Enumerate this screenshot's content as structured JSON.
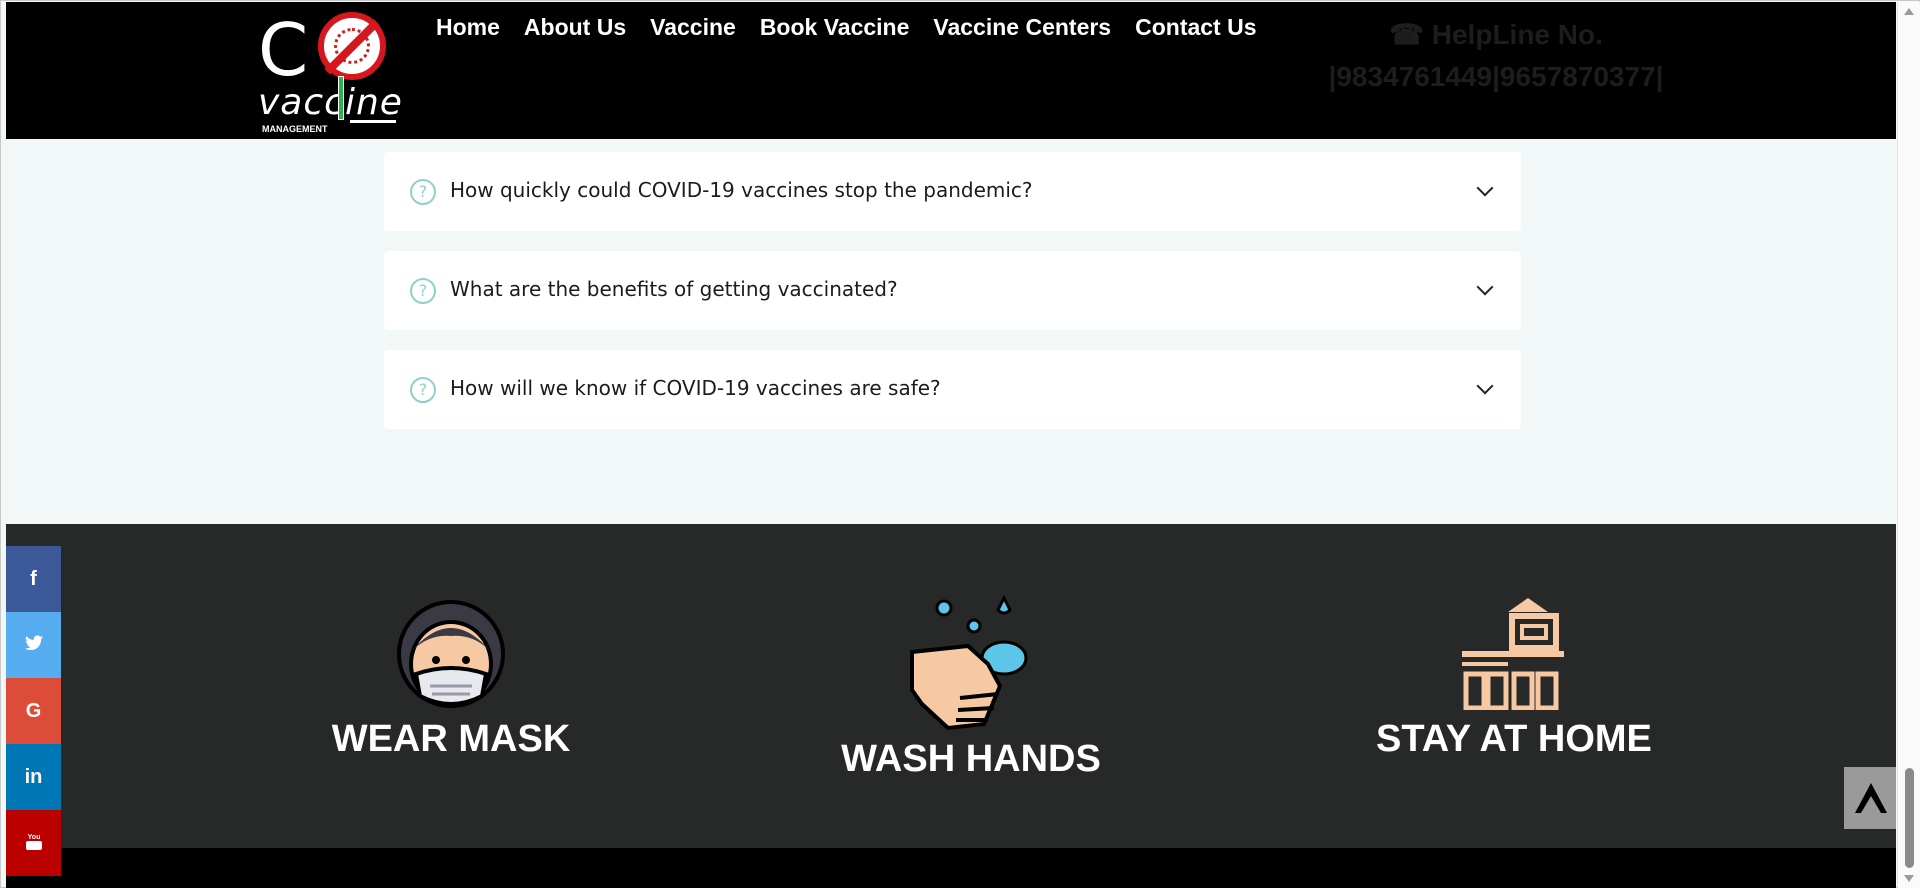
{
  "header": {
    "logo": {
      "co_text": "C",
      "brand_text": "vaccine",
      "sub_text": "MANAGEMENT"
    },
    "nav": [
      {
        "label": "Home"
      },
      {
        "label": "About Us"
      },
      {
        "label": "Vaccine"
      },
      {
        "label": "Book Vaccine"
      },
      {
        "label": "Vaccine Centers"
      },
      {
        "label": "Contact Us"
      }
    ],
    "helpline": {
      "line1": "☎ HelpLine No.",
      "line2": "|9834761449|9657870377|"
    }
  },
  "faq": {
    "items": [
      {
        "question": "How quickly could COVID-19 vaccines stop the pandemic?"
      },
      {
        "question": "What are the benefits of getting vaccinated?"
      },
      {
        "question": "How will we know if COVID-19 vaccines are safe?"
      }
    ]
  },
  "tips": [
    {
      "label": "WEAR MASK",
      "icon": "mask-icon"
    },
    {
      "label": "WASH HANDS",
      "icon": "wash-hands-icon"
    },
    {
      "label": "STAY AT HOME",
      "icon": "house-icon"
    }
  ],
  "social": [
    {
      "glyph": "f",
      "icon": "facebook-icon",
      "color": "#3b5998"
    },
    {
      "glyph": "🐦",
      "icon": "twitter-icon",
      "color": "#55acee"
    },
    {
      "glyph": "G",
      "icon": "google-icon",
      "color": "#dd4b39"
    },
    {
      "glyph": "in",
      "icon": "linkedin-icon",
      "color": "#0077b5"
    },
    {
      "glyph": "▶",
      "icon": "youtube-icon",
      "color": "#bb0000"
    }
  ],
  "colors": {
    "header_bg": "#000000",
    "page_bg": "#f2f8f7",
    "dark_section_bg": "#272828",
    "faq_icon": "#8fd1c8",
    "logo_red": "#d7171f"
  }
}
